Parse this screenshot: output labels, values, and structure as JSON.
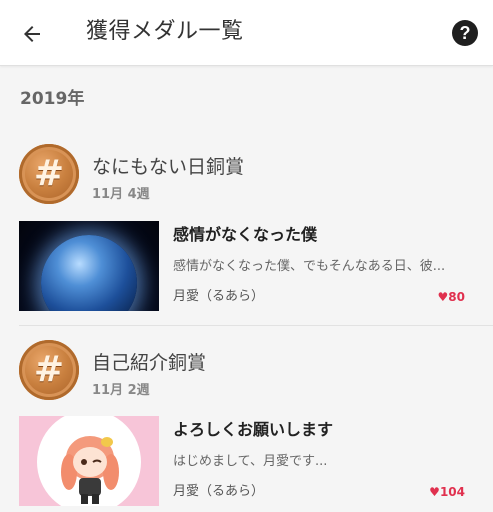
{
  "header": {
    "title": "獲得メダル一覧",
    "back_icon": "arrow-left-icon",
    "help_icon": "question-circle-icon",
    "help_label": "?"
  },
  "year": "2019年",
  "medals": [
    {
      "name": "なにもない日銅賞",
      "week": "11月 4週",
      "medal_symbol": "#",
      "medal_color": "#c9803f",
      "post": {
        "title": "感情がなくなった僕",
        "excerpt": "感情がなくなった僕、でもそんなある日、彼...",
        "author": "月愛（るあら）",
        "likes": "80"
      }
    },
    {
      "name": "自己紹介銅賞",
      "week": "11月 2週",
      "medal_symbol": "#",
      "medal_color": "#c9803f",
      "post": {
        "title": "よろしくお願いします",
        "excerpt": "はじめまして、月愛です...",
        "author": "月愛（るあら）",
        "likes": "104"
      }
    }
  ],
  "colors": {
    "like": "#e0304e",
    "background": "#f5f5f5",
    "bronze": "#c9803f"
  }
}
